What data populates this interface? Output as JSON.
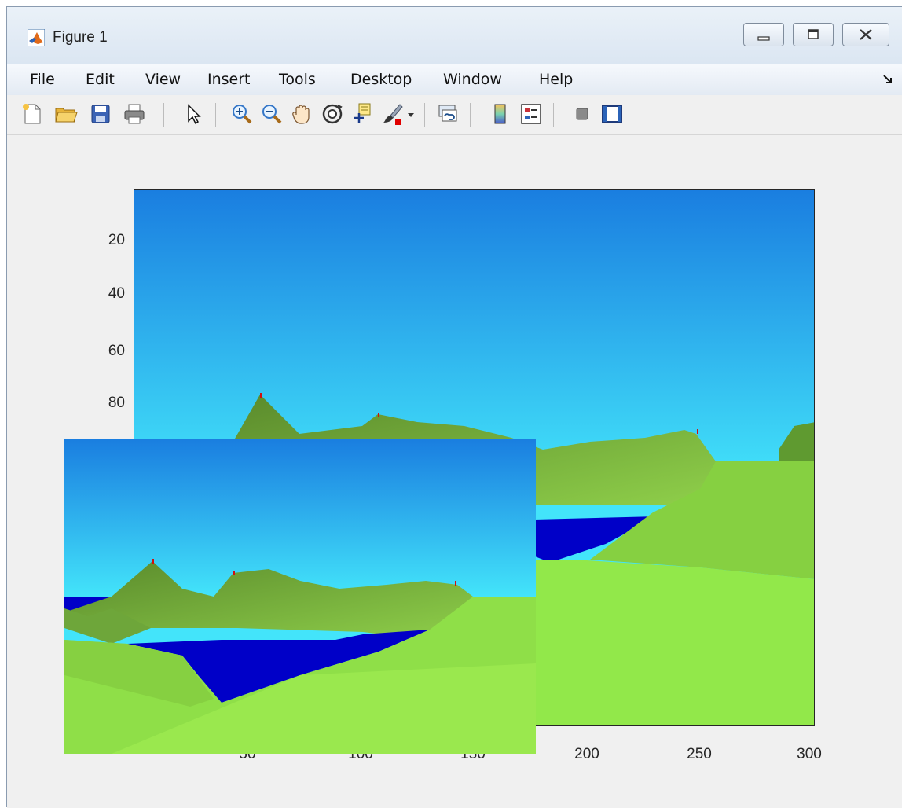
{
  "window": {
    "title": "Figure 1",
    "controls": {
      "minimize": "minimize",
      "maximize": "maximize",
      "close": "close"
    }
  },
  "menu": {
    "items": [
      "File",
      "Edit",
      "View",
      "Insert",
      "Tools",
      "Desktop",
      "Window",
      "Help"
    ]
  },
  "toolbar": {
    "icons": [
      "new-figure-icon",
      "open-file-icon",
      "save-icon",
      "print-icon",
      "pointer-icon",
      "zoom-in-icon",
      "zoom-out-icon",
      "pan-hand-icon",
      "rotate-3d-icon",
      "data-cursor-icon",
      "brush-icon",
      "link-plot-icon",
      "colorbar-icon",
      "legend-icon",
      "hide-plot-tools-icon",
      "show-plot-tools-icon"
    ]
  },
  "axes": {
    "yticks": [
      "20",
      "40",
      "60",
      "80"
    ],
    "xticks": [
      "200",
      "250",
      "300"
    ],
    "xticks_hidden": [
      "50",
      "100",
      "150"
    ]
  },
  "colors": {
    "sky_top": "#1a7ee0",
    "sky_bottom": "#43e4fa",
    "water": "#0000c8",
    "grass": "#92e84a",
    "hill": "#6a9e34"
  }
}
